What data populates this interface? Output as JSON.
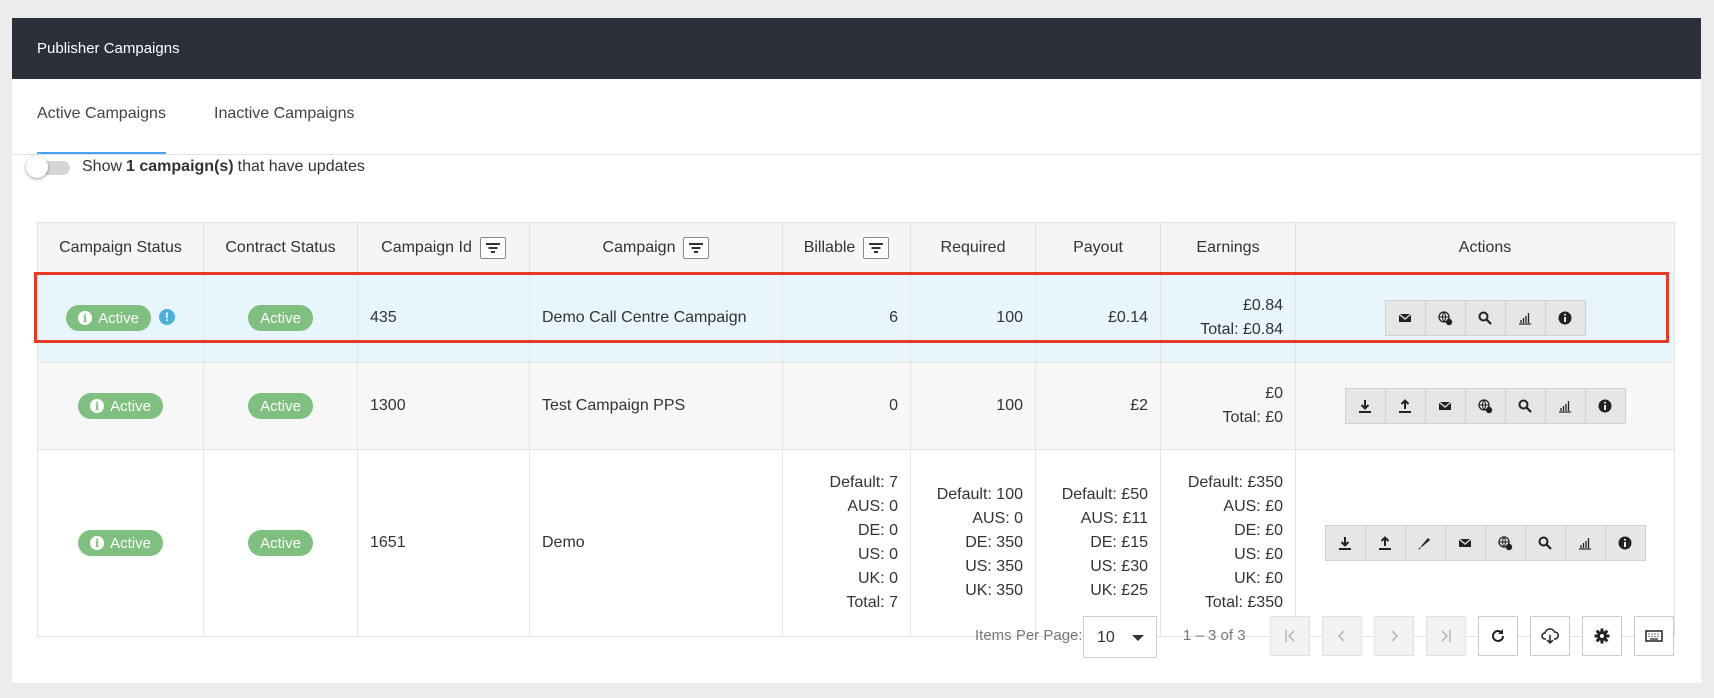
{
  "header": {
    "title": "Publisher Campaigns"
  },
  "tabs": [
    {
      "label": "Active Campaigns",
      "active": true
    },
    {
      "label": "Inactive Campaigns",
      "active": false
    }
  ],
  "toggle": {
    "prefix": "Show",
    "bold": "1 campaign(s)",
    "suffix": "that have updates",
    "on": false
  },
  "table": {
    "columns": [
      "Campaign Status",
      "Contract Status",
      "Campaign Id",
      "Campaign",
      "Billable",
      "Required",
      "Payout",
      "Earnings",
      "Actions"
    ],
    "rows": [
      {
        "campaign_status": "Active",
        "contract_status": "Active",
        "id": "435",
        "campaign": "Demo Call Centre Campaign",
        "billable": [
          "6"
        ],
        "required": [
          "100"
        ],
        "payout": [
          "£0.14"
        ],
        "earnings": [
          "£0.84",
          "Total: £0.84"
        ],
        "has_update": true,
        "actions": [
          "mail-icon",
          "globe-icon",
          "search-icon",
          "chart-icon",
          "info-icon"
        ]
      },
      {
        "campaign_status": "Active",
        "contract_status": "Active",
        "id": "1300",
        "campaign": "Test Campaign PPS",
        "billable": [
          "0"
        ],
        "required": [
          "100"
        ],
        "payout": [
          "£2"
        ],
        "earnings": [
          "£0",
          "Total: £0"
        ],
        "has_update": false,
        "actions": [
          "download-icon",
          "upload-icon",
          "mail-icon",
          "globe-icon",
          "search-icon",
          "chart-icon",
          "info-icon"
        ]
      },
      {
        "campaign_status": "Active",
        "contract_status": "Active",
        "id": "1651",
        "campaign": "Demo",
        "billable": [
          "Default: 7",
          "AUS: 0",
          "DE: 0",
          "US: 0",
          "UK: 0",
          "Total: 7"
        ],
        "required": [
          "Default: 100",
          "AUS: 0",
          "DE: 350",
          "US: 350",
          "UK: 350"
        ],
        "payout": [
          "Default: £50",
          "AUS: £11",
          "DE: £15",
          "US: £30",
          "UK: £25"
        ],
        "earnings": [
          "Default: £350",
          "AUS: £0",
          "DE: £0",
          "US: £0",
          "UK: £0",
          "Total: £350"
        ],
        "has_update": false,
        "actions": [
          "download-icon",
          "upload-icon",
          "edit-icon",
          "mail-icon",
          "globe-icon",
          "search-icon",
          "chart-icon",
          "info-icon"
        ]
      }
    ]
  },
  "pagination": {
    "items_per_page_label": "Items Per Page:",
    "items_per_page": "10",
    "range": "1 – 3 of 3"
  },
  "colors": {
    "header_bg": "#2b303b",
    "active_tab": "#42a5f5",
    "badge": "#7fbf7f",
    "highlight": "#e53a24",
    "row_selected": "#e8f5fc"
  }
}
